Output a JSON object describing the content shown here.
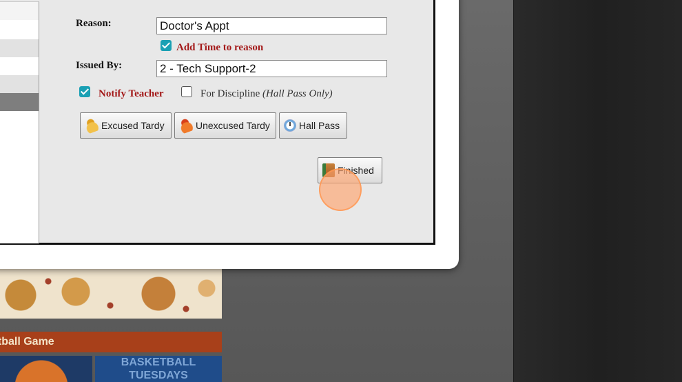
{
  "form": {
    "reason_label": "Reason:",
    "reason_value": "Doctor's Appt",
    "add_time_label": "Add Time to reason",
    "add_time_checked": true,
    "issued_by_label": "Issued By:",
    "issued_by_value": "2 - Tech Support-2",
    "notify_teacher_label": "Notify Teacher",
    "notify_teacher_checked": true,
    "for_discipline_label": "For Discipline",
    "for_discipline_note": "(Hall Pass Only)",
    "for_discipline_checked": false
  },
  "buttons": {
    "excused_tardy": "Excused Tardy",
    "unexcused_tardy": "Unexcused Tardy",
    "hall_pass": "Hall Pass",
    "finished": "Finished"
  },
  "icons": {
    "excused_tardy": "yellow-bell-icon",
    "unexcused_tardy": "orange-bell-icon",
    "hall_pass": "clock-icon",
    "finished": "exit-door-icon"
  },
  "background": {
    "game_bar_text": "etball Game",
    "basketball_text_line1": "BASKETBALL",
    "basketball_text_line2": "TUESDAYS"
  },
  "colors": {
    "checkbox_accent": "#1aa0b4",
    "label_red": "#a31818",
    "dialog_bg": "#e8e8e8"
  }
}
